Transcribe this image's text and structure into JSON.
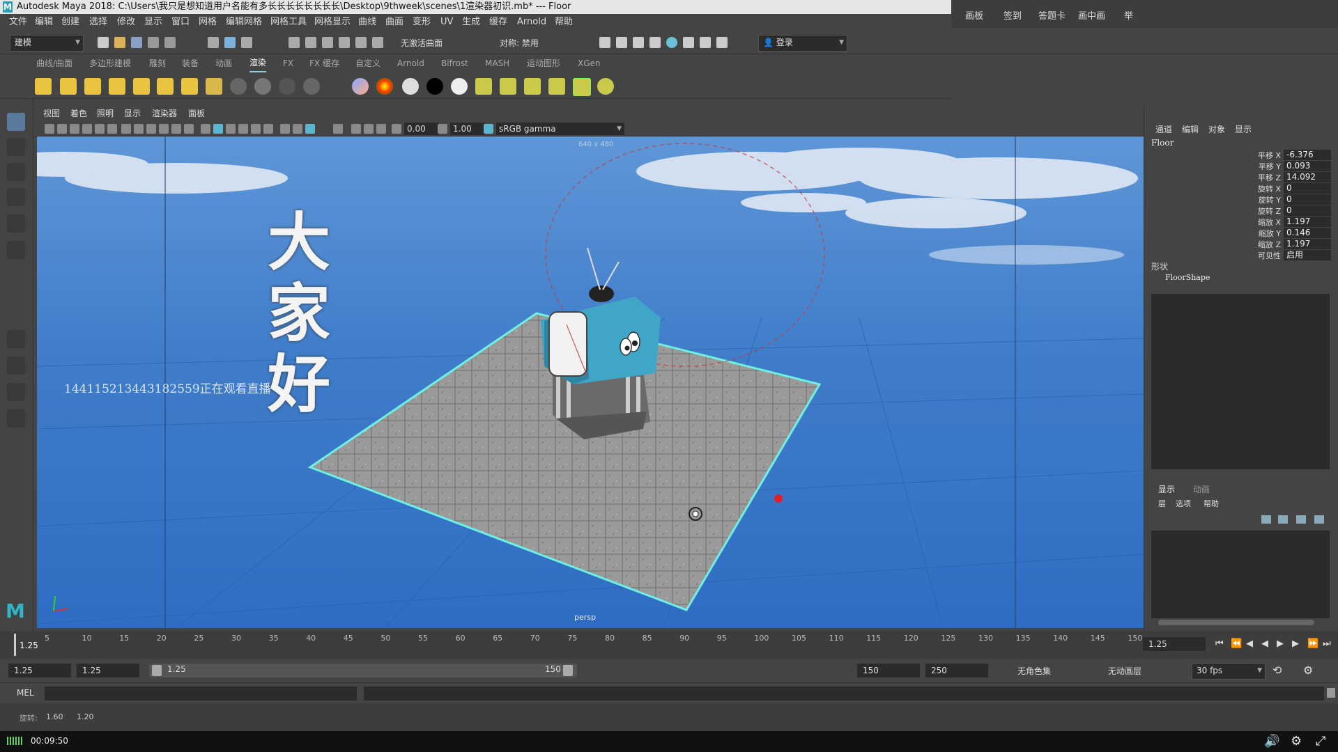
{
  "titlebar": {
    "title": "Autodesk Maya 2018: C:\\Users\\我只是想知道用户名能有多长长长长长长长长\\Desktop\\9thweek\\scenes\\1渲染器初识.mb*   ---   Floor"
  },
  "overlay_menu": [
    "画板",
    "签到",
    "答题卡",
    "画中画",
    "举"
  ],
  "menubar": [
    "文件",
    "编辑",
    "创建",
    "选择",
    "修改",
    "显示",
    "窗口",
    "网格",
    "编辑网格",
    "网格工具",
    "网格显示",
    "曲线",
    "曲面",
    "变形",
    "UV",
    "生成",
    "缓存",
    "Arnold",
    "帮助"
  ],
  "toolbar": {
    "mode": "建模",
    "live_surface": "无激活曲面",
    "symmetry": "对称: 禁用",
    "login": "登录"
  },
  "shelf_tabs": [
    "曲线/曲面",
    "多边形建模",
    "雕刻",
    "装备",
    "动画",
    "渲染",
    "FX",
    "FX 缓存",
    "自定义",
    "Arnold",
    "Bifrost",
    "MASH",
    "运动图形",
    "XGen"
  ],
  "shelf_active": "渲染",
  "panel_menu": [
    "视图",
    "着色",
    "照明",
    "显示",
    "渲染器",
    "面板"
  ],
  "viewport_toolbar": {
    "exposure": "0.00",
    "gamma": "1.00",
    "colorspace": "sRGB gamma"
  },
  "viewport": {
    "resolution": "640 x 480",
    "camera": "persp",
    "big_text": [
      "大",
      "家",
      "好"
    ],
    "watch_text": "14411521344318255​9正在观看直播"
  },
  "channel_box": {
    "tabs": [
      "通道",
      "编辑",
      "对象",
      "显示"
    ],
    "object": "Floor",
    "attributes": [
      {
        "label": "平移 X",
        "value": "-6.376"
      },
      {
        "label": "平移 Y",
        "value": "0.093"
      },
      {
        "label": "平移 Z",
        "value": "14.092"
      },
      {
        "label": "旋转 X",
        "value": "0"
      },
      {
        "label": "旋转 Y",
        "value": "0"
      },
      {
        "label": "旋转 Z",
        "value": "0"
      },
      {
        "label": "缩放 X",
        "value": "1.197"
      },
      {
        "label": "缩放 Y",
        "value": "0.146"
      },
      {
        "label": "缩放 Z",
        "value": "1.197"
      },
      {
        "label": "可见性",
        "value": "启用"
      }
    ],
    "shapes_header": "形状",
    "shape_name": "FloorShape",
    "layer_tabs": [
      "显示",
      "动画"
    ],
    "layer_menu": [
      "层",
      "选项",
      "帮助"
    ]
  },
  "timeline": {
    "ticks": [
      "5",
      "10",
      "15",
      "20",
      "25",
      "30",
      "35",
      "40",
      "45",
      "50",
      "55",
      "60",
      "65",
      "70",
      "75",
      "80",
      "85",
      "90",
      "95",
      "100",
      "105",
      "110",
      "115",
      "120",
      "125",
      "130",
      "135",
      "140",
      "145",
      "150"
    ],
    "current_start": "1.25",
    "current_frame": "1.25"
  },
  "range": {
    "start": "1.25",
    "playback_start": "1.25",
    "slider_start": "1.25",
    "slider_end": "150",
    "playback_end": "150",
    "end": "250",
    "character_set": "无角色集",
    "anim_layer": "无动画层",
    "fps": "30 fps"
  },
  "command": {
    "lang": "MEL"
  },
  "helpline": {
    "label": "旋转:",
    "v1": "1.60",
    "v2": "1.20"
  },
  "player": {
    "time": "00:09:50"
  }
}
